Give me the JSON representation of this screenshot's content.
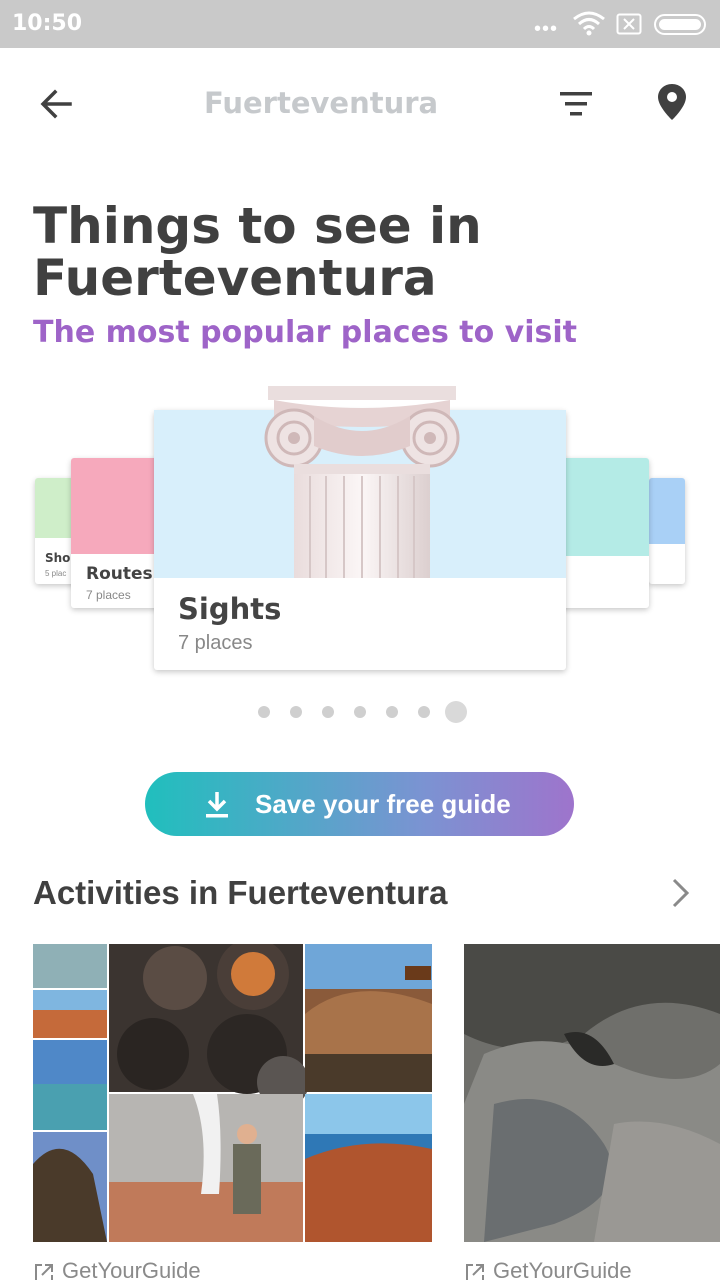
{
  "status_bar": {
    "time": "10:50",
    "dots": "•••",
    "icons": [
      "wifi-icon",
      "sim-error-icon",
      "battery-icon"
    ]
  },
  "app_bar": {
    "title": "Fuerteventura",
    "icons": [
      "back-arrow-icon",
      "filter-icon",
      "map-pin-icon"
    ]
  },
  "headline": {
    "title": "Things to see in Fuerteventura",
    "subtitle": "The most popular places to visit"
  },
  "carousel": {
    "cards": [
      {
        "name": "Sho",
        "count": "5 plac",
        "color": "#cfeec9"
      },
      {
        "name": "Routes",
        "count": "7 places",
        "color": "#f6a9bc"
      },
      {
        "name": "Sights",
        "count": "7 places",
        "color": "#d8effb"
      },
      {
        "name": "",
        "count": "",
        "color": "#b4ebe6"
      },
      {
        "name": "",
        "count": "",
        "color": "#a9d0f6"
      }
    ],
    "pages": 7,
    "active_page": 7
  },
  "cta": {
    "label": "Save your free guide",
    "icon": "download-icon",
    "gradient": [
      "#20bfbd",
      "#9e74cc"
    ]
  },
  "activities": {
    "title": "Activities in Fuerteventura",
    "items": [
      {
        "provider": "GetYourGuide"
      },
      {
        "provider": "GetYourGuide"
      }
    ]
  },
  "colors": {
    "accent_purple": "#9e64c8",
    "heading": "#404040",
    "appbar_title": "#c6c9cc"
  }
}
